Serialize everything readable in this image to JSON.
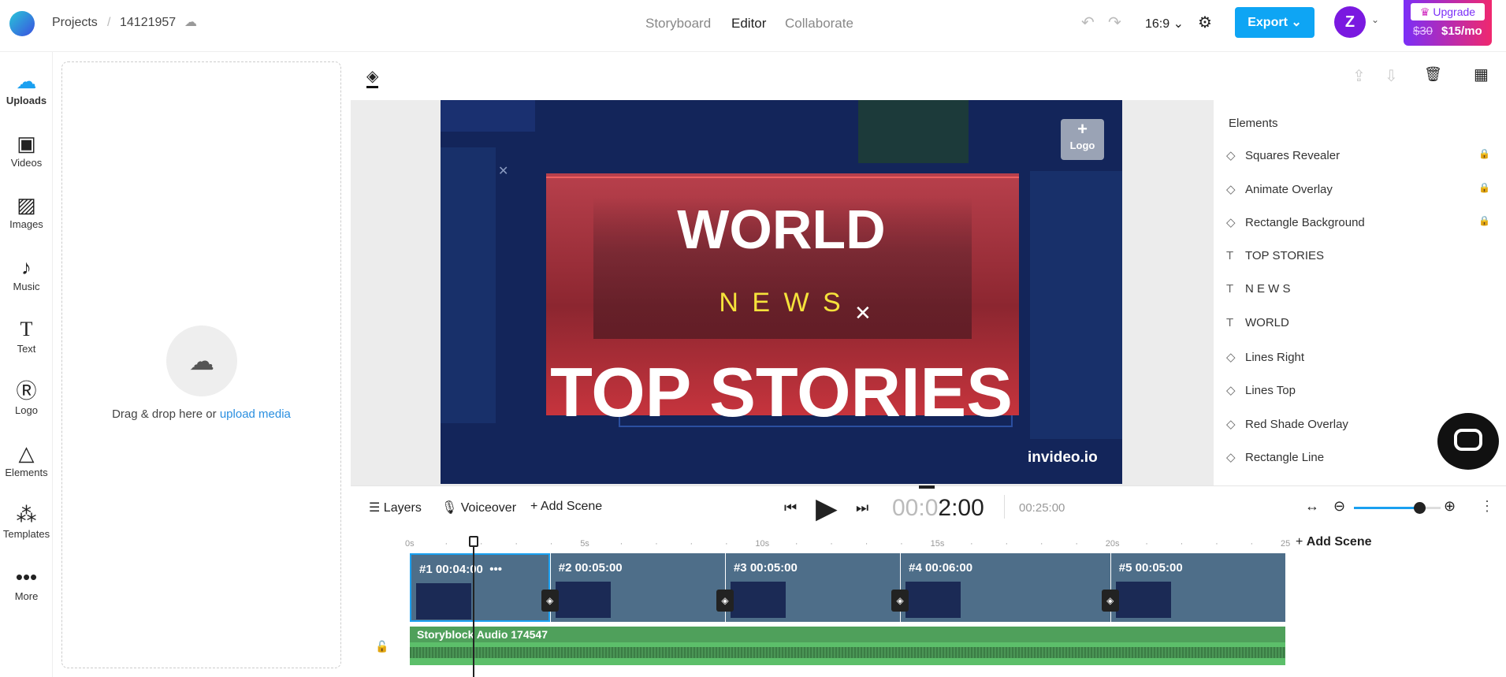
{
  "header": {
    "breadcrumb_root": "Projects",
    "project_id": "14121957",
    "tabs": [
      {
        "label": "Storyboard"
      },
      {
        "label": "Editor",
        "active": true
      },
      {
        "label": "Collaborate"
      }
    ],
    "aspect_ratio": "16:9",
    "export_label": "Export",
    "avatar_letter": "Z",
    "upgrade_label": "Upgrade",
    "old_price": "$30",
    "new_price": "$15/mo"
  },
  "rail": [
    {
      "label": "Uploads",
      "icon": "cloud-upload-icon"
    },
    {
      "label": "Videos",
      "icon": "video-icon"
    },
    {
      "label": "Images",
      "icon": "image-icon"
    },
    {
      "label": "Music",
      "icon": "music-icon"
    },
    {
      "label": "Text",
      "icon": "text-icon"
    },
    {
      "label": "Logo",
      "icon": "logo-icon"
    },
    {
      "label": "Elements",
      "icon": "shapes-icon"
    },
    {
      "label": "Templates",
      "icon": "templates-icon"
    },
    {
      "label": "More",
      "icon": "more-icon"
    }
  ],
  "upload": {
    "text": "Drag & drop here or ",
    "link": "upload media"
  },
  "video": {
    "title1": "WORLD",
    "title2": "N E W S",
    "title3": "TOP STORIES",
    "watermark": "invideo.io",
    "logo_label": "Logo"
  },
  "elements": {
    "title": "Elements",
    "items": [
      {
        "label": "Squares Revealer",
        "type": "shape",
        "locked": true
      },
      {
        "label": "Animate Overlay",
        "type": "shape",
        "locked": true
      },
      {
        "label": "Rectangle Background",
        "type": "shape",
        "locked": true
      },
      {
        "label": "TOP STORIES",
        "type": "text"
      },
      {
        "label": "N E W S",
        "type": "text"
      },
      {
        "label": "WORLD",
        "type": "text"
      },
      {
        "label": "Lines Right",
        "type": "shape"
      },
      {
        "label": "Lines  Top",
        "type": "shape"
      },
      {
        "label": "Red Shade Overlay",
        "type": "shape"
      },
      {
        "label": "Rectangle Line",
        "type": "shape"
      }
    ]
  },
  "timeline": {
    "layers_label": "Layers",
    "voiceover_label": "Voiceover",
    "add_scene_label": "Add Scene",
    "current_time_dim": "00:0",
    "current_time": "2:00",
    "total_time": "00:25:00",
    "zoom_level": 0.75,
    "ticks": [
      "0s",
      "5s",
      "10s",
      "15s",
      "20s",
      "25"
    ],
    "scenes": [
      {
        "label": "#1",
        "duration": "00:04:00",
        "seconds": 4
      },
      {
        "label": "#2",
        "duration": "00:05:00",
        "seconds": 5
      },
      {
        "label": "#3",
        "duration": "00:05:00",
        "seconds": 5
      },
      {
        "label": "#4",
        "duration": "00:06:00",
        "seconds": 6
      },
      {
        "label": "#5",
        "duration": "00:05:00",
        "seconds": 5
      }
    ],
    "audio_label": "Storyblock Audio 174547",
    "playhead_seconds": 1.8
  },
  "colors": {
    "accent": "#1aa0f0",
    "audio": "#5cbf6a",
    "scene": "#4e6e89",
    "upgrade_from": "#7b2ff7",
    "upgrade_to": "#f0286e"
  }
}
